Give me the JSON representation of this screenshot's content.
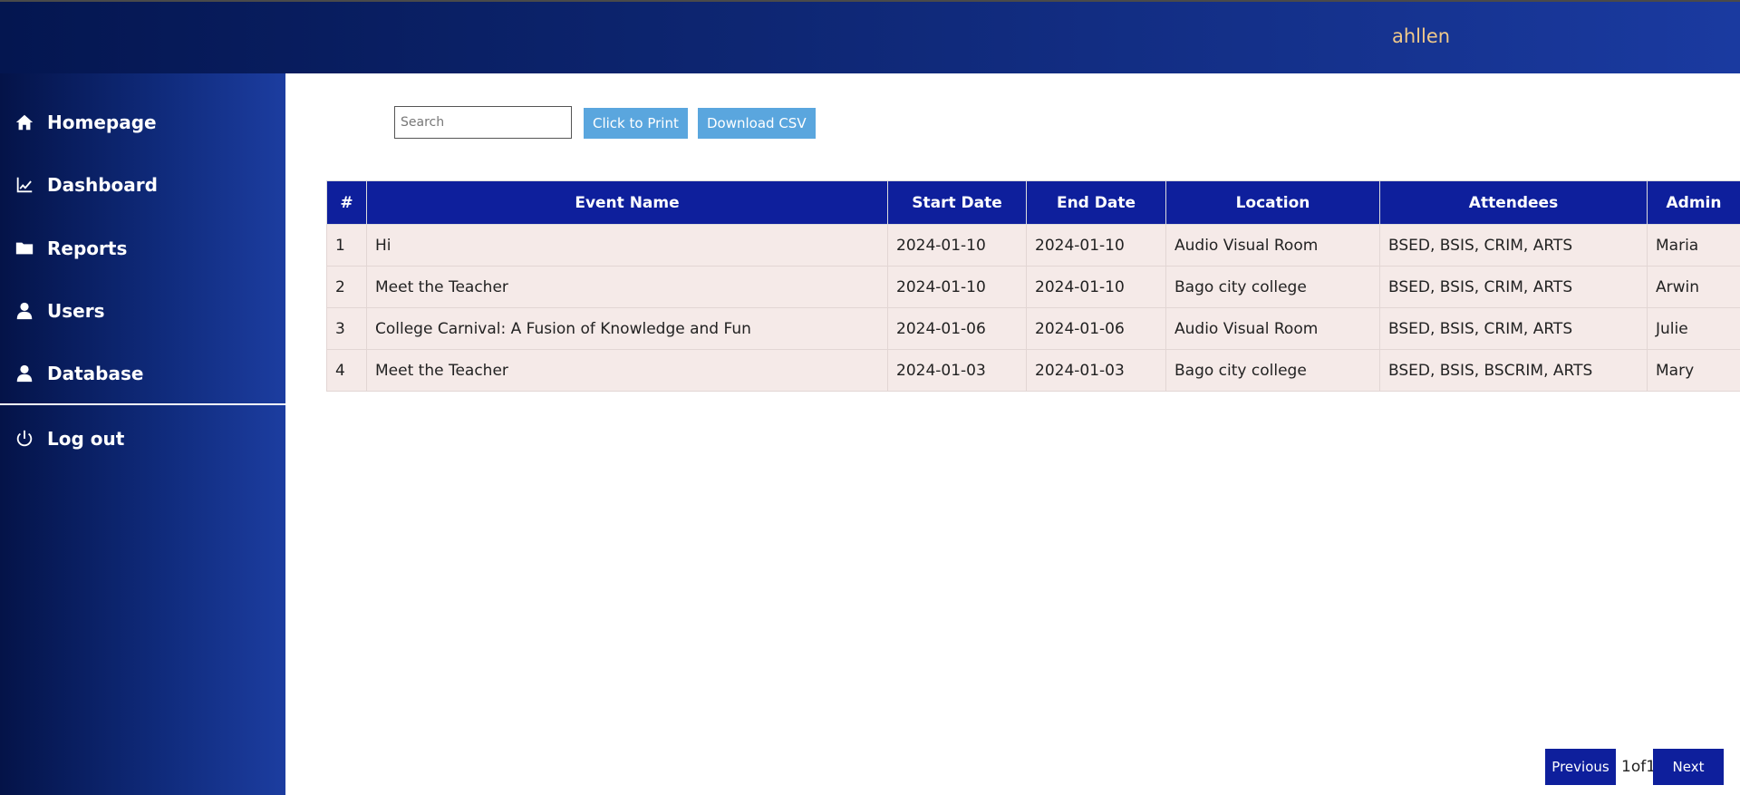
{
  "header": {
    "username": "ahllen"
  },
  "sidebar": {
    "items": [
      {
        "label": "Homepage",
        "icon": "home-icon"
      },
      {
        "label": "Dashboard",
        "icon": "chart-line-icon"
      },
      {
        "label": "Reports",
        "icon": "folder-icon"
      },
      {
        "label": "Users",
        "icon": "user-icon"
      },
      {
        "label": "Database",
        "icon": "user-icon"
      }
    ],
    "logout": {
      "label": "Log out",
      "icon": "power-icon"
    }
  },
  "toolbar": {
    "search_placeholder": "Search",
    "search_value": "",
    "print_label": "Click to Print",
    "csv_label": "Download CSV"
  },
  "table": {
    "headers": [
      "#",
      "Event Name",
      "Start Date",
      "End Date",
      "Location",
      "Attendees",
      "Admin"
    ],
    "rows": [
      [
        "1",
        "Hi",
        "2024-01-10",
        "2024-01-10",
        "Audio Visual Room",
        "BSED, BSIS, CRIM, ARTS",
        "Maria"
      ],
      [
        "2",
        "Meet the Teacher",
        "2024-01-10",
        "2024-01-10",
        "Bago city college",
        "BSED, BSIS, CRIM, ARTS",
        "Arwin"
      ],
      [
        "3",
        "College Carnival: A Fusion of Knowledge and Fun",
        "2024-01-06",
        "2024-01-06",
        "Audio Visual Room",
        "BSED, BSIS, CRIM, ARTS",
        "Julie"
      ],
      [
        "4",
        "Meet the Teacher",
        "2024-01-03",
        "2024-01-03",
        "Bago city college",
        "BSED, BSIS, BSCRIM, ARTS",
        "Mary"
      ]
    ]
  },
  "pagination": {
    "previous_label": "Previous",
    "page_info": "1of1",
    "next_label": "Next"
  },
  "colors": {
    "header_bg": "#0e1f9c",
    "row_bg": "#f5eae8",
    "action_button": "#5aa6de",
    "username": "#f0c98a"
  }
}
